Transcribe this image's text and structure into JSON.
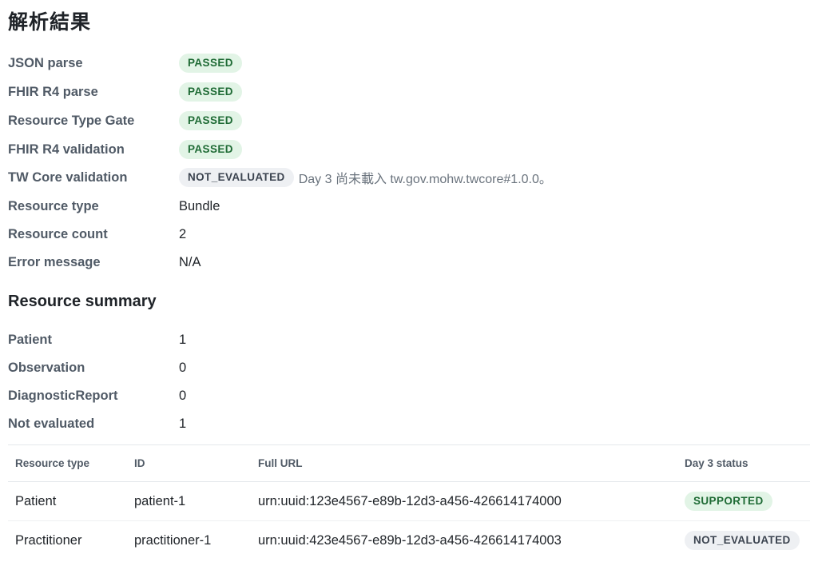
{
  "title": "解析結果",
  "checks": [
    {
      "label": "JSON parse",
      "status": "PASSED"
    },
    {
      "label": "FHIR R4 parse",
      "status": "PASSED"
    },
    {
      "label": "Resource Type Gate",
      "status": "PASSED"
    },
    {
      "label": "FHIR R4 validation",
      "status": "PASSED"
    },
    {
      "label": "TW Core validation",
      "status": "NOT_EVALUATED",
      "note": "Day 3 尚未載入 tw.gov.mohw.twcore#1.0.0。"
    }
  ],
  "details": [
    {
      "label": "Resource type",
      "value": "Bundle"
    },
    {
      "label": "Resource count",
      "value": "2"
    },
    {
      "label": "Error message",
      "value": "N/A"
    }
  ],
  "summary_title": "Resource summary",
  "summary": [
    {
      "label": "Patient",
      "value": "1"
    },
    {
      "label": "Observation",
      "value": "0"
    },
    {
      "label": "DiagnosticReport",
      "value": "0"
    },
    {
      "label": "Not evaluated",
      "value": "1"
    }
  ],
  "table": {
    "headers": [
      "Resource type",
      "ID",
      "Full URL",
      "Day 3 status"
    ],
    "rows": [
      {
        "type": "Patient",
        "id": "patient-1",
        "url": "urn:uuid:123e4567-e89b-12d3-a456-426614174000",
        "status": "SUPPORTED"
      },
      {
        "type": "Practitioner",
        "id": "practitioner-1",
        "url": "urn:uuid:423e4567-e89b-12d3-a456-426614174003",
        "status": "NOT_EVALUATED"
      }
    ]
  },
  "colors": {
    "passed_bg": "#e2f4e6",
    "passed_fg": "#1f6b35",
    "neutral_bg": "#eef0f3",
    "neutral_fg": "#3c4450"
  }
}
